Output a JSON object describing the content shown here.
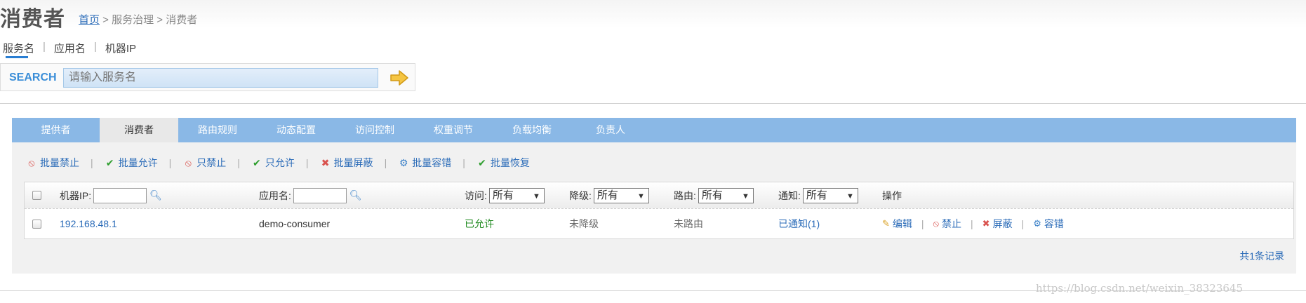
{
  "header": {
    "title": "消费者",
    "breadcrumb": {
      "home": "首页",
      "rest": " > 服务治理 > 消费者"
    }
  },
  "search": {
    "tabs": [
      "服务名",
      "应用名",
      "机器IP"
    ],
    "label": "SEARCH",
    "placeholder": "请输入服务名",
    "go_icon": "arrow-right-icon"
  },
  "tabs": [
    {
      "label": "提供者"
    },
    {
      "label": "消费者",
      "active": true
    },
    {
      "label": "路由规则"
    },
    {
      "label": "动态配置"
    },
    {
      "label": "访问控制"
    },
    {
      "label": "权重调节"
    },
    {
      "label": "负载均衡"
    },
    {
      "label": "负责人"
    }
  ],
  "actions": [
    {
      "label": "批量禁止",
      "icon": "forbid-icon"
    },
    {
      "label": "批量允许",
      "icon": "check-icon"
    },
    {
      "label": "只禁止",
      "icon": "forbid-icon"
    },
    {
      "label": "只允许",
      "icon": "check-icon"
    },
    {
      "label": "批量屏蔽",
      "icon": "block-icon"
    },
    {
      "label": "批量容错",
      "icon": "tolerance-icon"
    },
    {
      "label": "批量恢复",
      "icon": "check-icon"
    }
  ],
  "grid": {
    "head": {
      "ip_label": "机器IP:",
      "app_label": "应用名:",
      "access_label": "访问:",
      "access_value": "所有",
      "degrade_label": "降级:",
      "degrade_value": "所有",
      "route_label": "路由:",
      "route_value": "所有",
      "notify_label": "通知:",
      "notify_value": "所有",
      "ops_label": "操作"
    },
    "rows": [
      {
        "ip": "192.168.48.1",
        "app": "demo-consumer",
        "access": "已允许",
        "degrade": "未降级",
        "route": "未路由",
        "notify": "已通知(1)",
        "ops": {
          "edit": "编辑",
          "forbid": "禁止",
          "block": "屏蔽",
          "tolerance": "容错"
        }
      }
    ]
  },
  "total": "共1条记录",
  "watermark": "https://blog.csdn.net/weixin_38323645",
  "colors": {
    "tabbar": "#8ab8e6",
    "link": "#2a6bb8",
    "allowed": "#1f8a1f",
    "forbid": "#d9534f"
  }
}
